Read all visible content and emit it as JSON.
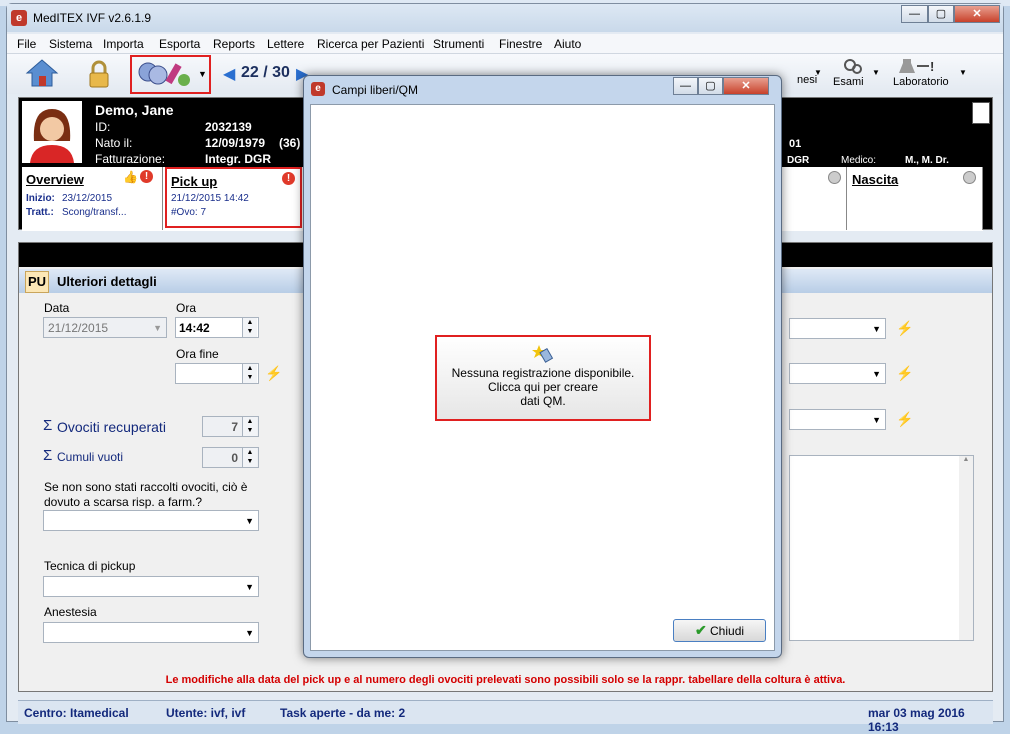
{
  "app": {
    "title": "MedITEX IVF v2.6.1.9",
    "icon_letter": "e"
  },
  "menu": [
    "File",
    "Sistema",
    "Importa",
    "Esporta",
    "Reports",
    "Lettere",
    "Ricerca per Pazienti",
    "Strumenti",
    "Finestre",
    "Aiuto"
  ],
  "toolbar": {
    "nav_counter": "22 / 30",
    "esami": "Esami",
    "laboratorio": "Laboratorio",
    "anamnesi_partial": "nesi"
  },
  "patient": {
    "name": "Demo, Jane",
    "id_label": "ID:",
    "id": "2032139",
    "nato_label": "Nato il:",
    "nato": "12/09/1979",
    "age": "(36)",
    "fatt_label": "Fatturazione:",
    "fatt": "Integr. DGR",
    "extra_num": "01",
    "dgr": "DGR",
    "medico_label": "Medico:",
    "medico": "M., M. Dr."
  },
  "ptabs": {
    "overview": {
      "title": "Overview",
      "inizio_label": "Inizio:",
      "inizio": "23/12/2015",
      "tratt_label": "Tratt.:",
      "tratt": "Scong/transf..."
    },
    "pickup": {
      "title": "Pick up",
      "datetime": "21/12/2015 14:42",
      "ovo": "#Ovo: 7"
    },
    "nascita": {
      "title": "Nascita"
    }
  },
  "section": {
    "pu_tab": "PU",
    "dettagli": "Ulteriori dettagli"
  },
  "form": {
    "data_label": "Data",
    "data_value": "21/12/2015",
    "ora_label": "Ora",
    "ora_value": "14:42",
    "ora_fine_label": "Ora fine",
    "ovociti_label": "Ovociti recuperati",
    "ovociti_value": "7",
    "cumuli_label": "Cumuli vuoti",
    "cumuli_value": "0",
    "question": "Se non sono stati raccolti ovociti, ciò è dovuto a scarsa risp. a farm.?",
    "tecnica_label": "Tecnica di pickup",
    "anestesia_label": "Anestesia",
    "sigma": "Σ"
  },
  "warning": "Le modifiche alla data del pick up e al numero degli ovociti prelevati sono possibili solo se la rappr. tabellare della coltura è attiva.",
  "status": {
    "centro": "Centro: Itamedical",
    "utente": "Utente: ivf, ivf",
    "task": "Task aperte - da me: 2",
    "datetime": "mar 03 mag 2016 16:13"
  },
  "dialog": {
    "title": "Campi liberi/QM",
    "empty_line1": "Nessuna registrazione disponibile.",
    "empty_line2": "Clicca qui per creare",
    "empty_line3": "dati QM.",
    "close": "Chiudi"
  }
}
